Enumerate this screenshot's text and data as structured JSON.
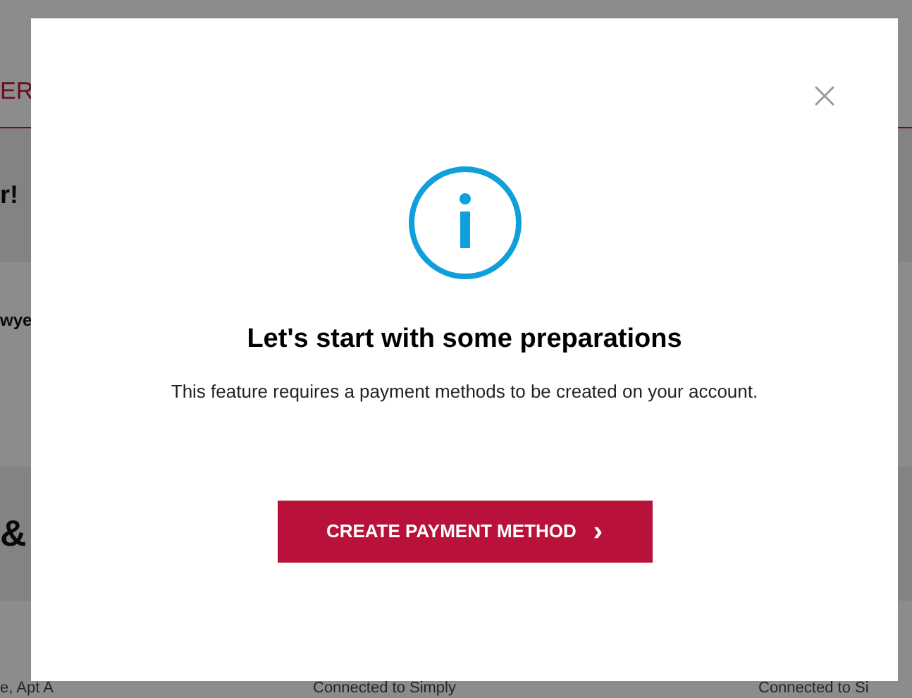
{
  "background_page": {
    "nav_text": "ER",
    "greeting": "r!",
    "row_left": "wye",
    "section_heading": "&",
    "footer_left": "e, Apt A",
    "footer_items": [
      "Connected to Simply",
      "Connected to Si"
    ]
  },
  "dialog": {
    "title": "Let's start with some preparations",
    "message": "This feature requires a payment methods to be created on your account.",
    "button": "CREATE PAYMENT METHOD",
    "button_chevron": "›"
  }
}
